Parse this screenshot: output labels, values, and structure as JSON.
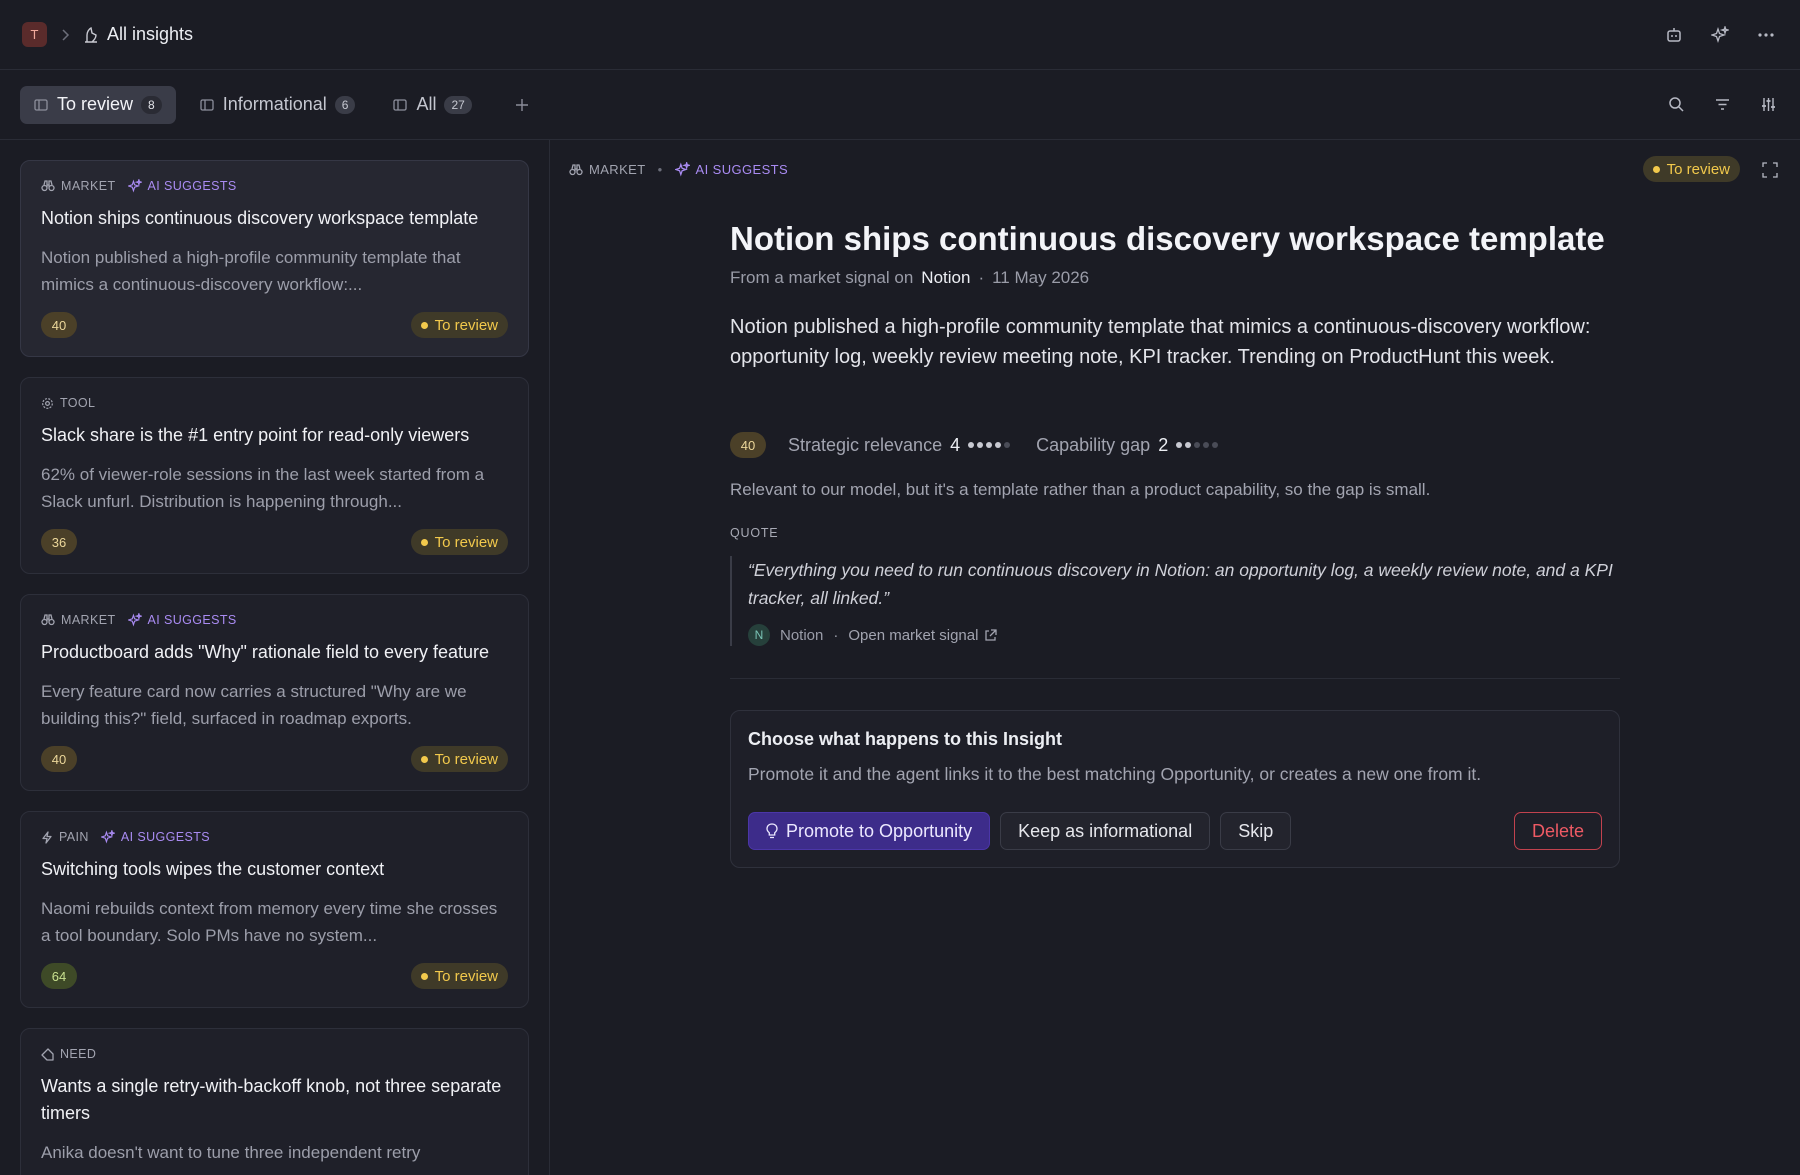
{
  "header": {
    "workspace_initial": "T",
    "title": "All insights"
  },
  "tabs": [
    {
      "label": "To review",
      "count": "8"
    },
    {
      "label": "Informational",
      "count": "6"
    },
    {
      "label": "All",
      "count": "27"
    }
  ],
  "list": {
    "cards": [
      {
        "tag": "MARKET",
        "ai": "AI SUGGESTS",
        "title": "Notion ships continuous discovery workspace template",
        "body": "Notion published a high-profile community template that mimics a continuous-discovery workflow:...",
        "score": "40",
        "status": "To review"
      },
      {
        "tag": "TOOL",
        "ai": "",
        "title": "Slack share is the #1 entry point for read-only viewers",
        "body": "62% of viewer-role sessions in the last week started from a Slack unfurl. Distribution is happening through...",
        "score": "36",
        "status": "To review"
      },
      {
        "tag": "MARKET",
        "ai": "AI SUGGESTS",
        "title": "Productboard adds \"Why\" rationale field to every feature",
        "body": "Every feature card now carries a structured \"Why are we building this?\" field, surfaced in roadmap exports.",
        "score": "40",
        "status": "To review"
      },
      {
        "tag": "PAIN",
        "ai": "AI SUGGESTS",
        "title": "Switching tools wipes the customer context",
        "body": "Naomi rebuilds context from memory every time she crosses a tool boundary. Solo PMs have no system...",
        "score": "64",
        "status": "To review"
      },
      {
        "tag": "NEED",
        "ai": "",
        "title": "Wants a single retry-with-backoff knob, not three separate timers",
        "body": "Anika doesn't want to tune three independent retry",
        "score": "",
        "status": ""
      }
    ]
  },
  "detail": {
    "tag": "MARKET",
    "ai": "AI SUGGESTS",
    "status": "To review",
    "title": "Notion ships continuous discovery workspace template",
    "meta_prefix": "From a market signal on",
    "meta_source": "Notion",
    "meta_sep": "·",
    "meta_date": "11 May 2026",
    "description": "Notion published a high-profile community template that mimics a continuous-discovery workflow: opportunity log, weekly review meeting note, KPI tracker. Trending on ProductHunt this week.",
    "score": "40",
    "strategic_label": "Strategic relevance",
    "strategic_value": "4",
    "strategic_max": 5,
    "capability_label": "Capability gap",
    "capability_value": "2",
    "capability_max": 5,
    "rationale": "Relevant to our model, but it's a template rather than a product capability, so the gap is small.",
    "quote_label": "QUOTE",
    "quote_text": "“Everything you need to run continuous discovery in Notion: an opportunity log, a weekly review note, and a KPI tracker, all linked.”",
    "quote_source_initial": "N",
    "quote_source": "Notion",
    "quote_sep": "·",
    "open_link": "Open market signal",
    "action": {
      "title": "Choose what happens to this Insight",
      "subtitle": "Promote it and the agent links it to the best matching Opportunity, or creates a new one from it.",
      "promote": "Promote to Opportunity",
      "keep": "Keep as informational",
      "skip": "Skip",
      "delete": "Delete"
    }
  },
  "colors": {
    "accent": "#3d2c8a",
    "status_yellow": "#f2c94c",
    "ai_purple": "#a98bf2",
    "danger": "#ee5a64"
  }
}
